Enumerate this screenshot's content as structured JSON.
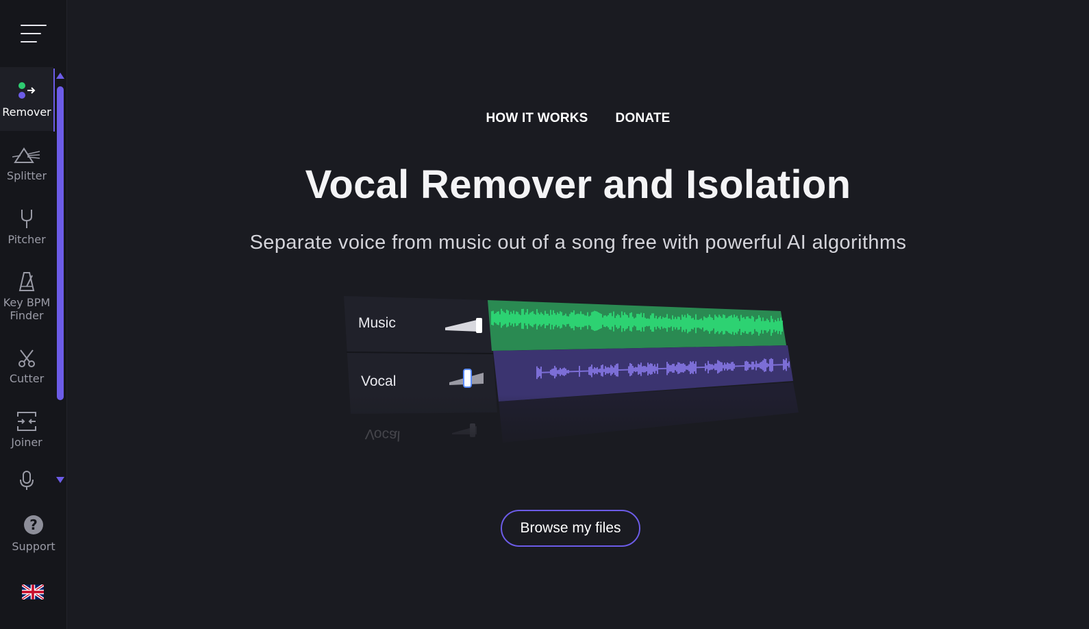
{
  "sidebar": {
    "menu_icon": "hamburger-menu-icon",
    "items": [
      {
        "id": "remover",
        "label": "Remover",
        "icon": "remover-icon",
        "active": true
      },
      {
        "id": "splitter",
        "label": "Splitter",
        "icon": "prism-icon"
      },
      {
        "id": "pitcher",
        "label": "Pitcher",
        "icon": "tuning-fork-icon"
      },
      {
        "id": "key-bpm-finder",
        "label": "Key BPM Finder",
        "icon": "metronome-icon"
      },
      {
        "id": "cutter",
        "label": "Cutter",
        "icon": "scissors-icon"
      },
      {
        "id": "joiner",
        "label": "Joiner",
        "icon": "joiner-icon"
      },
      {
        "id": "recorder",
        "label": "",
        "icon": "microphone-icon"
      }
    ],
    "support": {
      "label": "Support",
      "icon": "question-mark-icon"
    },
    "language_flag": "uk-flag-icon"
  },
  "topnav": {
    "how_it_works": "HOW IT WORKS",
    "donate": "DONATE"
  },
  "hero": {
    "title": "Vocal Remover and Isolation",
    "subtitle": "Separate voice from music out of a song free with powerful AI algorithms"
  },
  "illustration": {
    "tracks": [
      {
        "label": "Music",
        "color": "#2ee57a",
        "bg": "#2a8a52"
      },
      {
        "label": "Vocal",
        "color": "#8d7cf0",
        "bg": "#3b3470"
      }
    ],
    "reflection_label": "Vocal"
  },
  "browse_button": {
    "label": "Browse my files"
  },
  "colors": {
    "accent": "#6c5ce7",
    "background": "#1a1b21",
    "sidebar": "#15161b"
  }
}
